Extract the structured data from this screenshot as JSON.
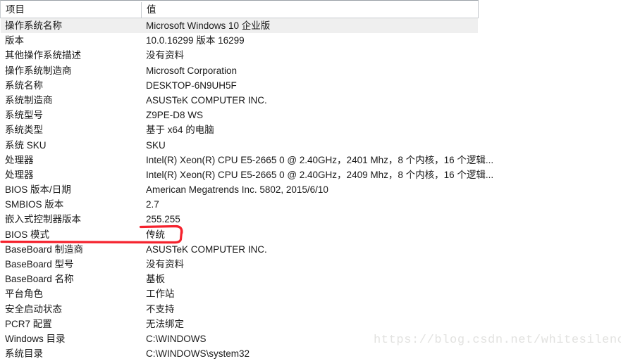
{
  "table": {
    "columns": {
      "item_header": "项目",
      "value_header": "值"
    },
    "rows": [
      {
        "item": "操作系统名称",
        "value": "Microsoft Windows 10 企业版",
        "selected": true
      },
      {
        "item": "版本",
        "value": "10.0.16299 版本 16299",
        "selected": false
      },
      {
        "item": "其他操作系统描述",
        "value": "没有资料",
        "selected": false
      },
      {
        "item": "操作系统制造商",
        "value": "Microsoft Corporation",
        "selected": false
      },
      {
        "item": "系统名称",
        "value": "DESKTOP-6N9UH5F",
        "selected": false
      },
      {
        "item": "系统制造商",
        "value": "ASUSTeK COMPUTER INC.",
        "selected": false
      },
      {
        "item": "系统型号",
        "value": "Z9PE-D8 WS",
        "selected": false
      },
      {
        "item": "系统类型",
        "value": "基于 x64 的电脑",
        "selected": false
      },
      {
        "item": "系统 SKU",
        "value": "SKU",
        "selected": false
      },
      {
        "item": "处理器",
        "value": "Intel(R) Xeon(R) CPU E5-2665 0 @ 2.40GHz，2401 Mhz，8 个内核，16 个逻辑...",
        "selected": false
      },
      {
        "item": "处理器",
        "value": "Intel(R) Xeon(R) CPU E5-2665 0 @ 2.40GHz，2409 Mhz，8 个内核，16 个逻辑...",
        "selected": false
      },
      {
        "item": "BIOS 版本/日期",
        "value": "American Megatrends Inc. 5802, 2015/6/10",
        "selected": false
      },
      {
        "item": "SMBIOS 版本",
        "value": "2.7",
        "selected": false
      },
      {
        "item": "嵌入式控制器版本",
        "value": "255.255",
        "selected": false
      },
      {
        "item": "BIOS 模式",
        "value": "传统",
        "selected": false
      },
      {
        "item": "BaseBoard 制造商",
        "value": "ASUSTeK COMPUTER INC.",
        "selected": false
      },
      {
        "item": "BaseBoard 型号",
        "value": "没有资料",
        "selected": false
      },
      {
        "item": "BaseBoard 名称",
        "value": "基板",
        "selected": false
      },
      {
        "item": "平台角色",
        "value": "工作站",
        "selected": false
      },
      {
        "item": "安全启动状态",
        "value": "不支持",
        "selected": false
      },
      {
        "item": "PCR7 配置",
        "value": "无法绑定",
        "selected": false
      },
      {
        "item": "Windows 目录",
        "value": "C:\\WINDOWS",
        "selected": false
      },
      {
        "item": "系统目录",
        "value": "C:\\WINDOWS\\system32",
        "selected": false
      }
    ]
  },
  "annotation": {
    "name": "bios-mode-highlight",
    "target_text": "传统",
    "color": "#f5222d"
  },
  "watermark": {
    "text": "https://blog.csdn.net/whitesilence",
    "color": "#e2e2e0"
  },
  "colors": {
    "selected_row_bg": "#efefef",
    "text": "#1a1a1a",
    "border": "#c8ccd0",
    "header_top_border": "#9aa0a6"
  }
}
